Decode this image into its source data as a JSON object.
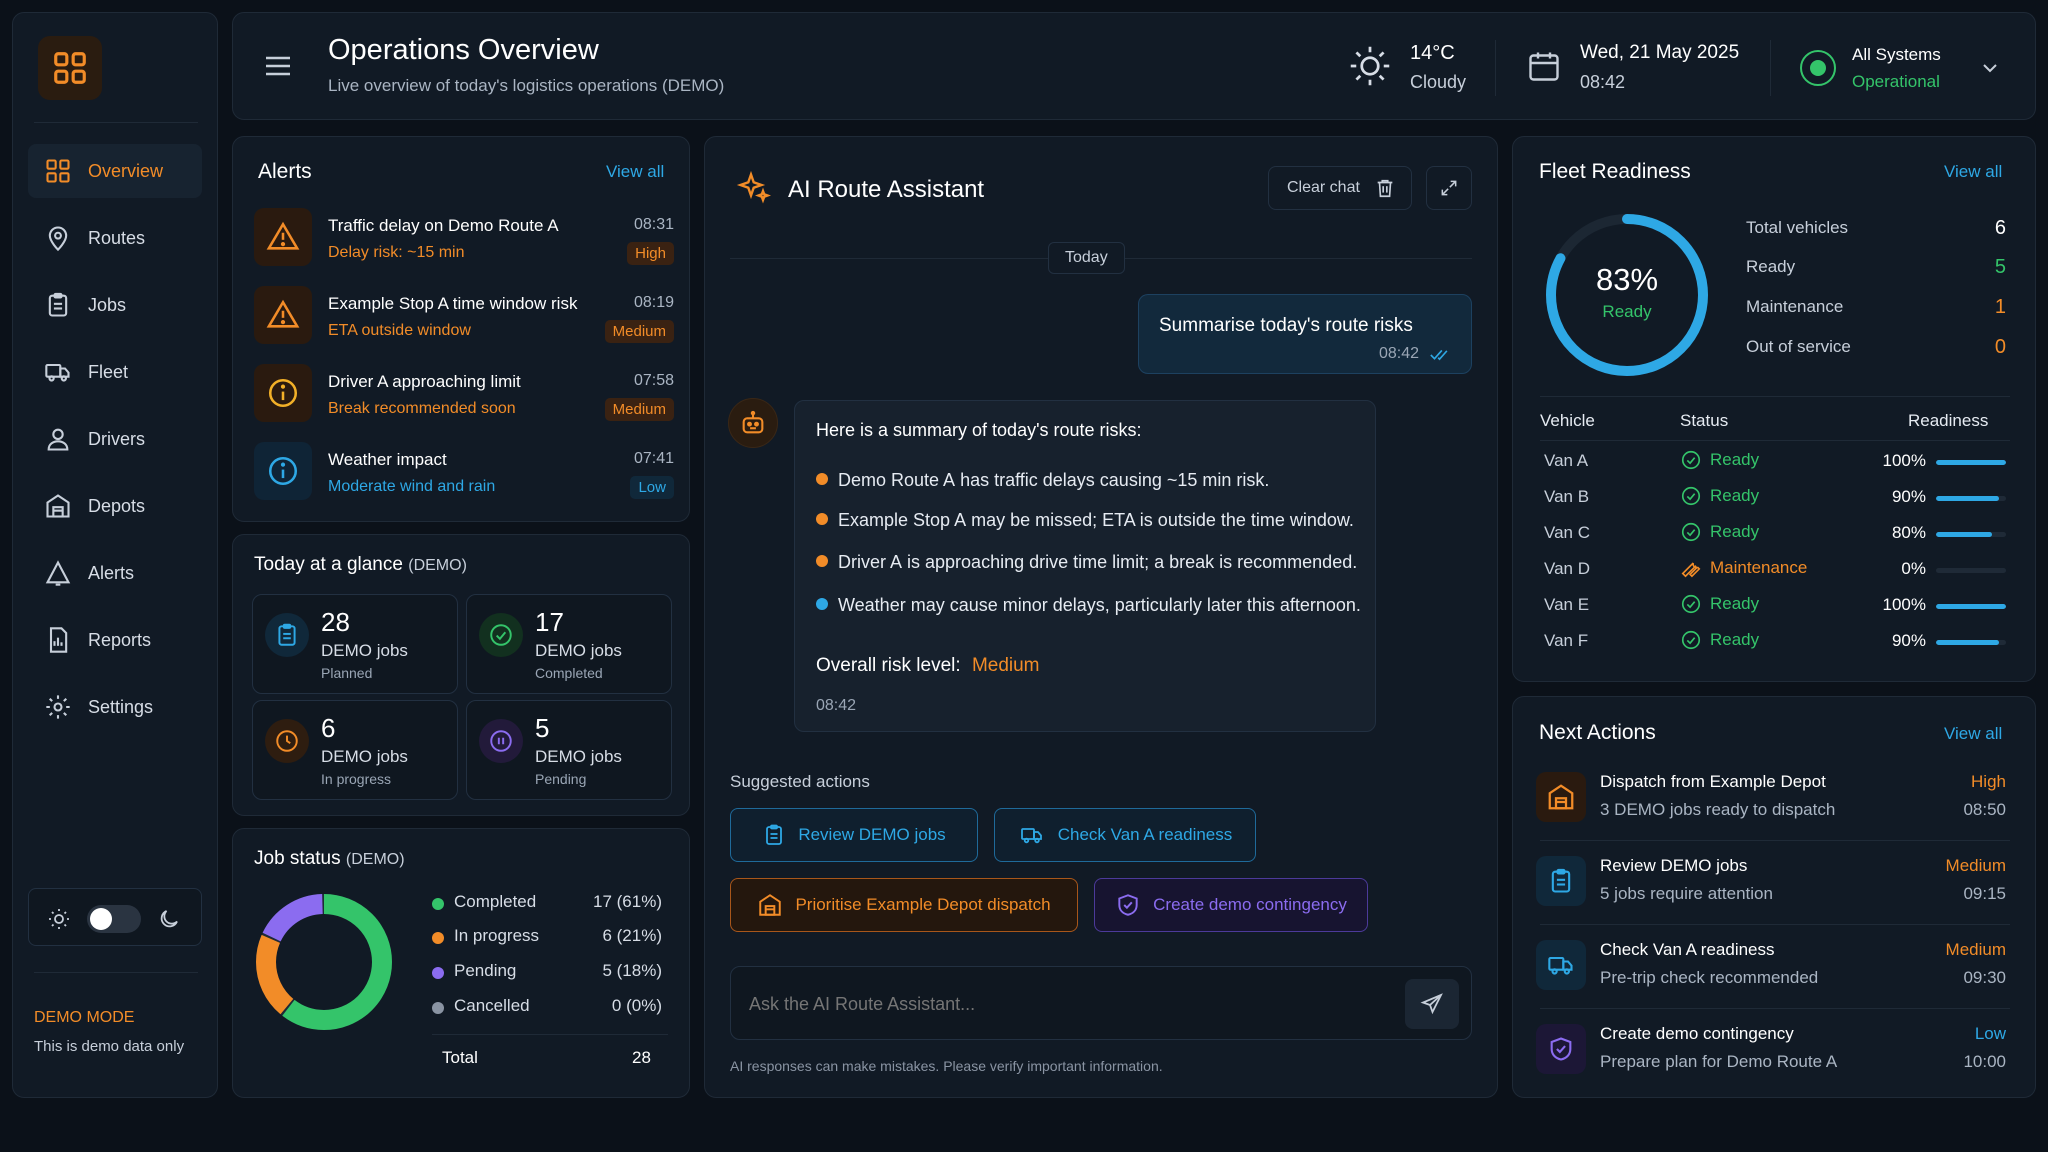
{
  "sidebar": {
    "items": [
      {
        "label": "Overview",
        "icon": "grid-icon"
      },
      {
        "label": "Routes",
        "icon": "map-pin-icon"
      },
      {
        "label": "Jobs",
        "icon": "clipboard-icon"
      },
      {
        "label": "Fleet",
        "icon": "truck-icon"
      },
      {
        "label": "Drivers",
        "icon": "user-icon"
      },
      {
        "label": "Depots",
        "icon": "warehouse-icon"
      },
      {
        "label": "Alerts",
        "icon": "bell-icon"
      },
      {
        "label": "Reports",
        "icon": "report-icon"
      },
      {
        "label": "Settings",
        "icon": "gear-icon"
      }
    ],
    "demo_mode": "DEMO MODE",
    "demo_note": "This is demo data only"
  },
  "header": {
    "title": "Operations Overview",
    "subtitle": "Live overview of today's logistics operations (DEMO)",
    "temperature": "14°C",
    "weather": "Cloudy",
    "date": "Wed, 21 May 2025",
    "time": "08:42",
    "system_status_line1": "All Systems",
    "system_status_line2": "Operational"
  },
  "alerts": {
    "title": "Alerts",
    "view_all": "View all",
    "items": [
      {
        "title": "Traffic delay on Demo Route A",
        "sub": "Delay risk: ~15 min",
        "time": "08:31",
        "level": "High"
      },
      {
        "title": "Example Stop A time window risk",
        "sub": "ETA outside window",
        "time": "08:19",
        "level": "Medium"
      },
      {
        "title": "Driver A approaching limit",
        "sub": "Break recommended soon",
        "time": "07:58",
        "level": "Medium"
      },
      {
        "title": "Weather impact",
        "sub": "Moderate wind and rain",
        "time": "07:41",
        "level": "Low"
      }
    ]
  },
  "glance": {
    "title": "Today at a glance",
    "tag": "(DEMO)",
    "boxes": [
      {
        "num": "28",
        "l1": "DEMO jobs",
        "l2": "Planned"
      },
      {
        "num": "17",
        "l1": "DEMO jobs",
        "l2": "Completed"
      },
      {
        "num": "6",
        "l1": "DEMO jobs",
        "l2": "In progress"
      },
      {
        "num": "5",
        "l1": "DEMO jobs",
        "l2": "Pending"
      }
    ]
  },
  "job_status": {
    "title": "Job status",
    "tag": "(DEMO)",
    "legend": [
      {
        "label": "Completed",
        "value": "17 (61%)",
        "color": "#34c46a"
      },
      {
        "label": "In progress",
        "value": "6 (21%)",
        "color": "#f28c28"
      },
      {
        "label": "Pending",
        "value": "5 (18%)",
        "color": "#8b6cf0"
      },
      {
        "label": "Cancelled",
        "value": "0 (0%)",
        "color": "#8a94a3"
      }
    ],
    "total_label": "Total",
    "total_value": "28",
    "segments": [
      {
        "name": "Completed",
        "fraction": 0.61,
        "color": "#34c46a"
      },
      {
        "name": "In progress",
        "fraction": 0.21,
        "color": "#f28c28"
      },
      {
        "name": "Pending",
        "fraction": 0.18,
        "color": "#8b6cf0"
      }
    ]
  },
  "assistant": {
    "title": "AI Route Assistant",
    "clear_chat": "Clear chat",
    "day_divider": "Today",
    "user_message": "Summarise today's route risks",
    "user_time": "08:42",
    "bot_intro": "Here is a summary of today's route risks:",
    "bullets": [
      {
        "bold": "Demo Route A",
        "text": " has traffic delays causing ~15 min risk.",
        "color": "#f28c28"
      },
      {
        "bold": "Example Stop A",
        "text": " may be missed; ETA is outside the time window.",
        "color": "#f28c28"
      },
      {
        "bold": "Driver A",
        "text": " is approaching drive time limit; a break is recommended.",
        "color": "#f28c28"
      },
      {
        "bold": "",
        "text": "Weather may cause minor delays, particularly later this afternoon.",
        "color": "#2ea8e5"
      }
    ],
    "risk_label": "Overall risk level:",
    "risk_value": "Medium",
    "bot_time": "08:42",
    "suggested_title": "Suggested actions",
    "actions": [
      {
        "label": "Review DEMO jobs"
      },
      {
        "label": "Check Van A readiness"
      },
      {
        "label": "Prioritise Example Depot dispatch"
      },
      {
        "label": "Create demo contingency"
      }
    ],
    "input_placeholder": "Ask the AI Route Assistant...",
    "disclaimer": "AI responses can make mistakes. Please verify important information."
  },
  "fleet": {
    "title": "Fleet Readiness",
    "view_all": "View all",
    "percent": "83%",
    "percent_label": "Ready",
    "readiness_fraction": 0.83,
    "stats": [
      {
        "label": "Total vehicles",
        "value": "6",
        "color": "#ffffff"
      },
      {
        "label": "Ready",
        "value": "5",
        "color": "#34c46a"
      },
      {
        "label": "Maintenance",
        "value": "1",
        "color": "#f28c28"
      },
      {
        "label": "Out of service",
        "value": "0",
        "color": "#f28c28"
      }
    ],
    "columns": [
      "Vehicle",
      "Status",
      "Readiness"
    ],
    "vehicles": [
      {
        "name": "Van A",
        "status": "Ready",
        "pct": "100%",
        "fill": 1.0
      },
      {
        "name": "Van B",
        "status": "Ready",
        "pct": "90%",
        "fill": 0.9
      },
      {
        "name": "Van C",
        "status": "Ready",
        "pct": "80%",
        "fill": 0.8
      },
      {
        "name": "Van D",
        "status": "Maintenance",
        "pct": "0%",
        "fill": 0.0
      },
      {
        "name": "Van E",
        "status": "Ready",
        "pct": "100%",
        "fill": 1.0
      },
      {
        "name": "Van F",
        "status": "Ready",
        "pct": "90%",
        "fill": 0.9
      }
    ]
  },
  "next_actions": {
    "title": "Next Actions",
    "view_all": "View all",
    "items": [
      {
        "title": "Dispatch from Example Depot",
        "sub": "3 DEMO jobs ready to dispatch",
        "priority": "High",
        "time": "08:50"
      },
      {
        "title": "Review DEMO jobs",
        "sub": "5 jobs require attention",
        "priority": "Medium",
        "time": "09:15"
      },
      {
        "title": "Check Van A readiness",
        "sub": "Pre-trip check recommended",
        "priority": "Medium",
        "time": "09:30"
      },
      {
        "title": "Create demo contingency",
        "sub": "Prepare plan for Demo Route A",
        "priority": "Low",
        "time": "10:00"
      }
    ]
  },
  "colors": {
    "accent_orange": "#f28c28",
    "accent_blue": "#2ea8e5",
    "accent_green": "#34c46a",
    "accent_purple": "#8b6cf0",
    "background": "#0b1119"
  }
}
